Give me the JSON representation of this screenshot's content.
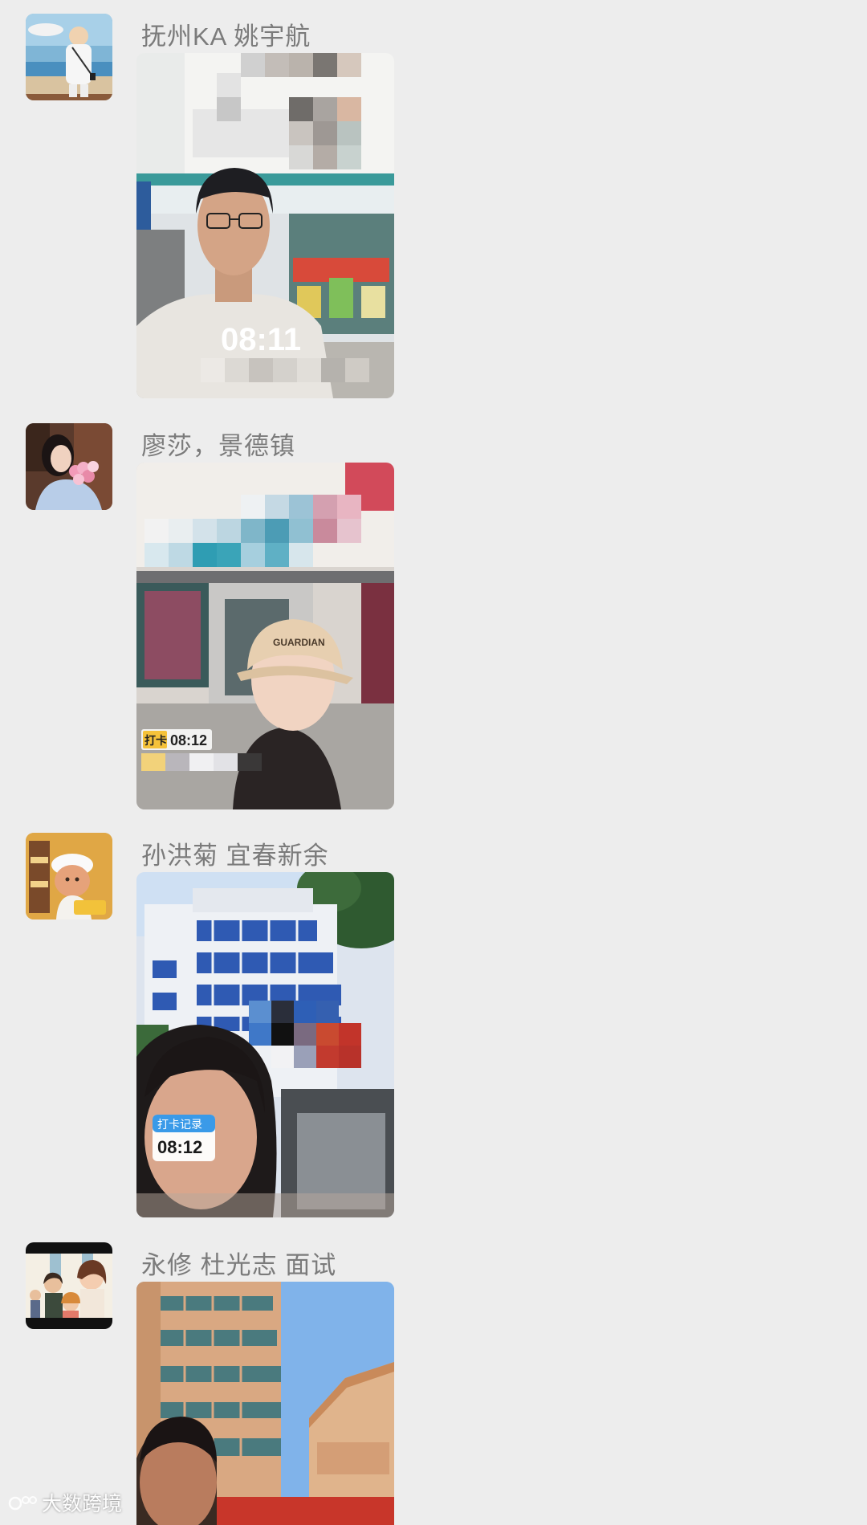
{
  "messages": [
    {
      "sender": "抚州KA 姚宇航",
      "avatar_icon": "avatar-boy-seaside",
      "photo_time": "08:11",
      "photo_badge": ""
    },
    {
      "sender": "廖莎，景德镇",
      "avatar_icon": "avatar-girl-flowers",
      "photo_time": "08:12",
      "photo_badge": "打卡"
    },
    {
      "sender": "孙洪菊 宜春新余",
      "avatar_icon": "avatar-cartoon-chef",
      "photo_time": "08:12",
      "photo_badge": "打卡记录"
    },
    {
      "sender": "永修 杜光志 面试",
      "avatar_icon": "avatar-cartoon-family",
      "photo_time": "",
      "photo_badge": ""
    }
  ],
  "watermark": "大数跨境",
  "colors": {
    "background": "#ededed",
    "sender_text": "#7b7b7b"
  }
}
